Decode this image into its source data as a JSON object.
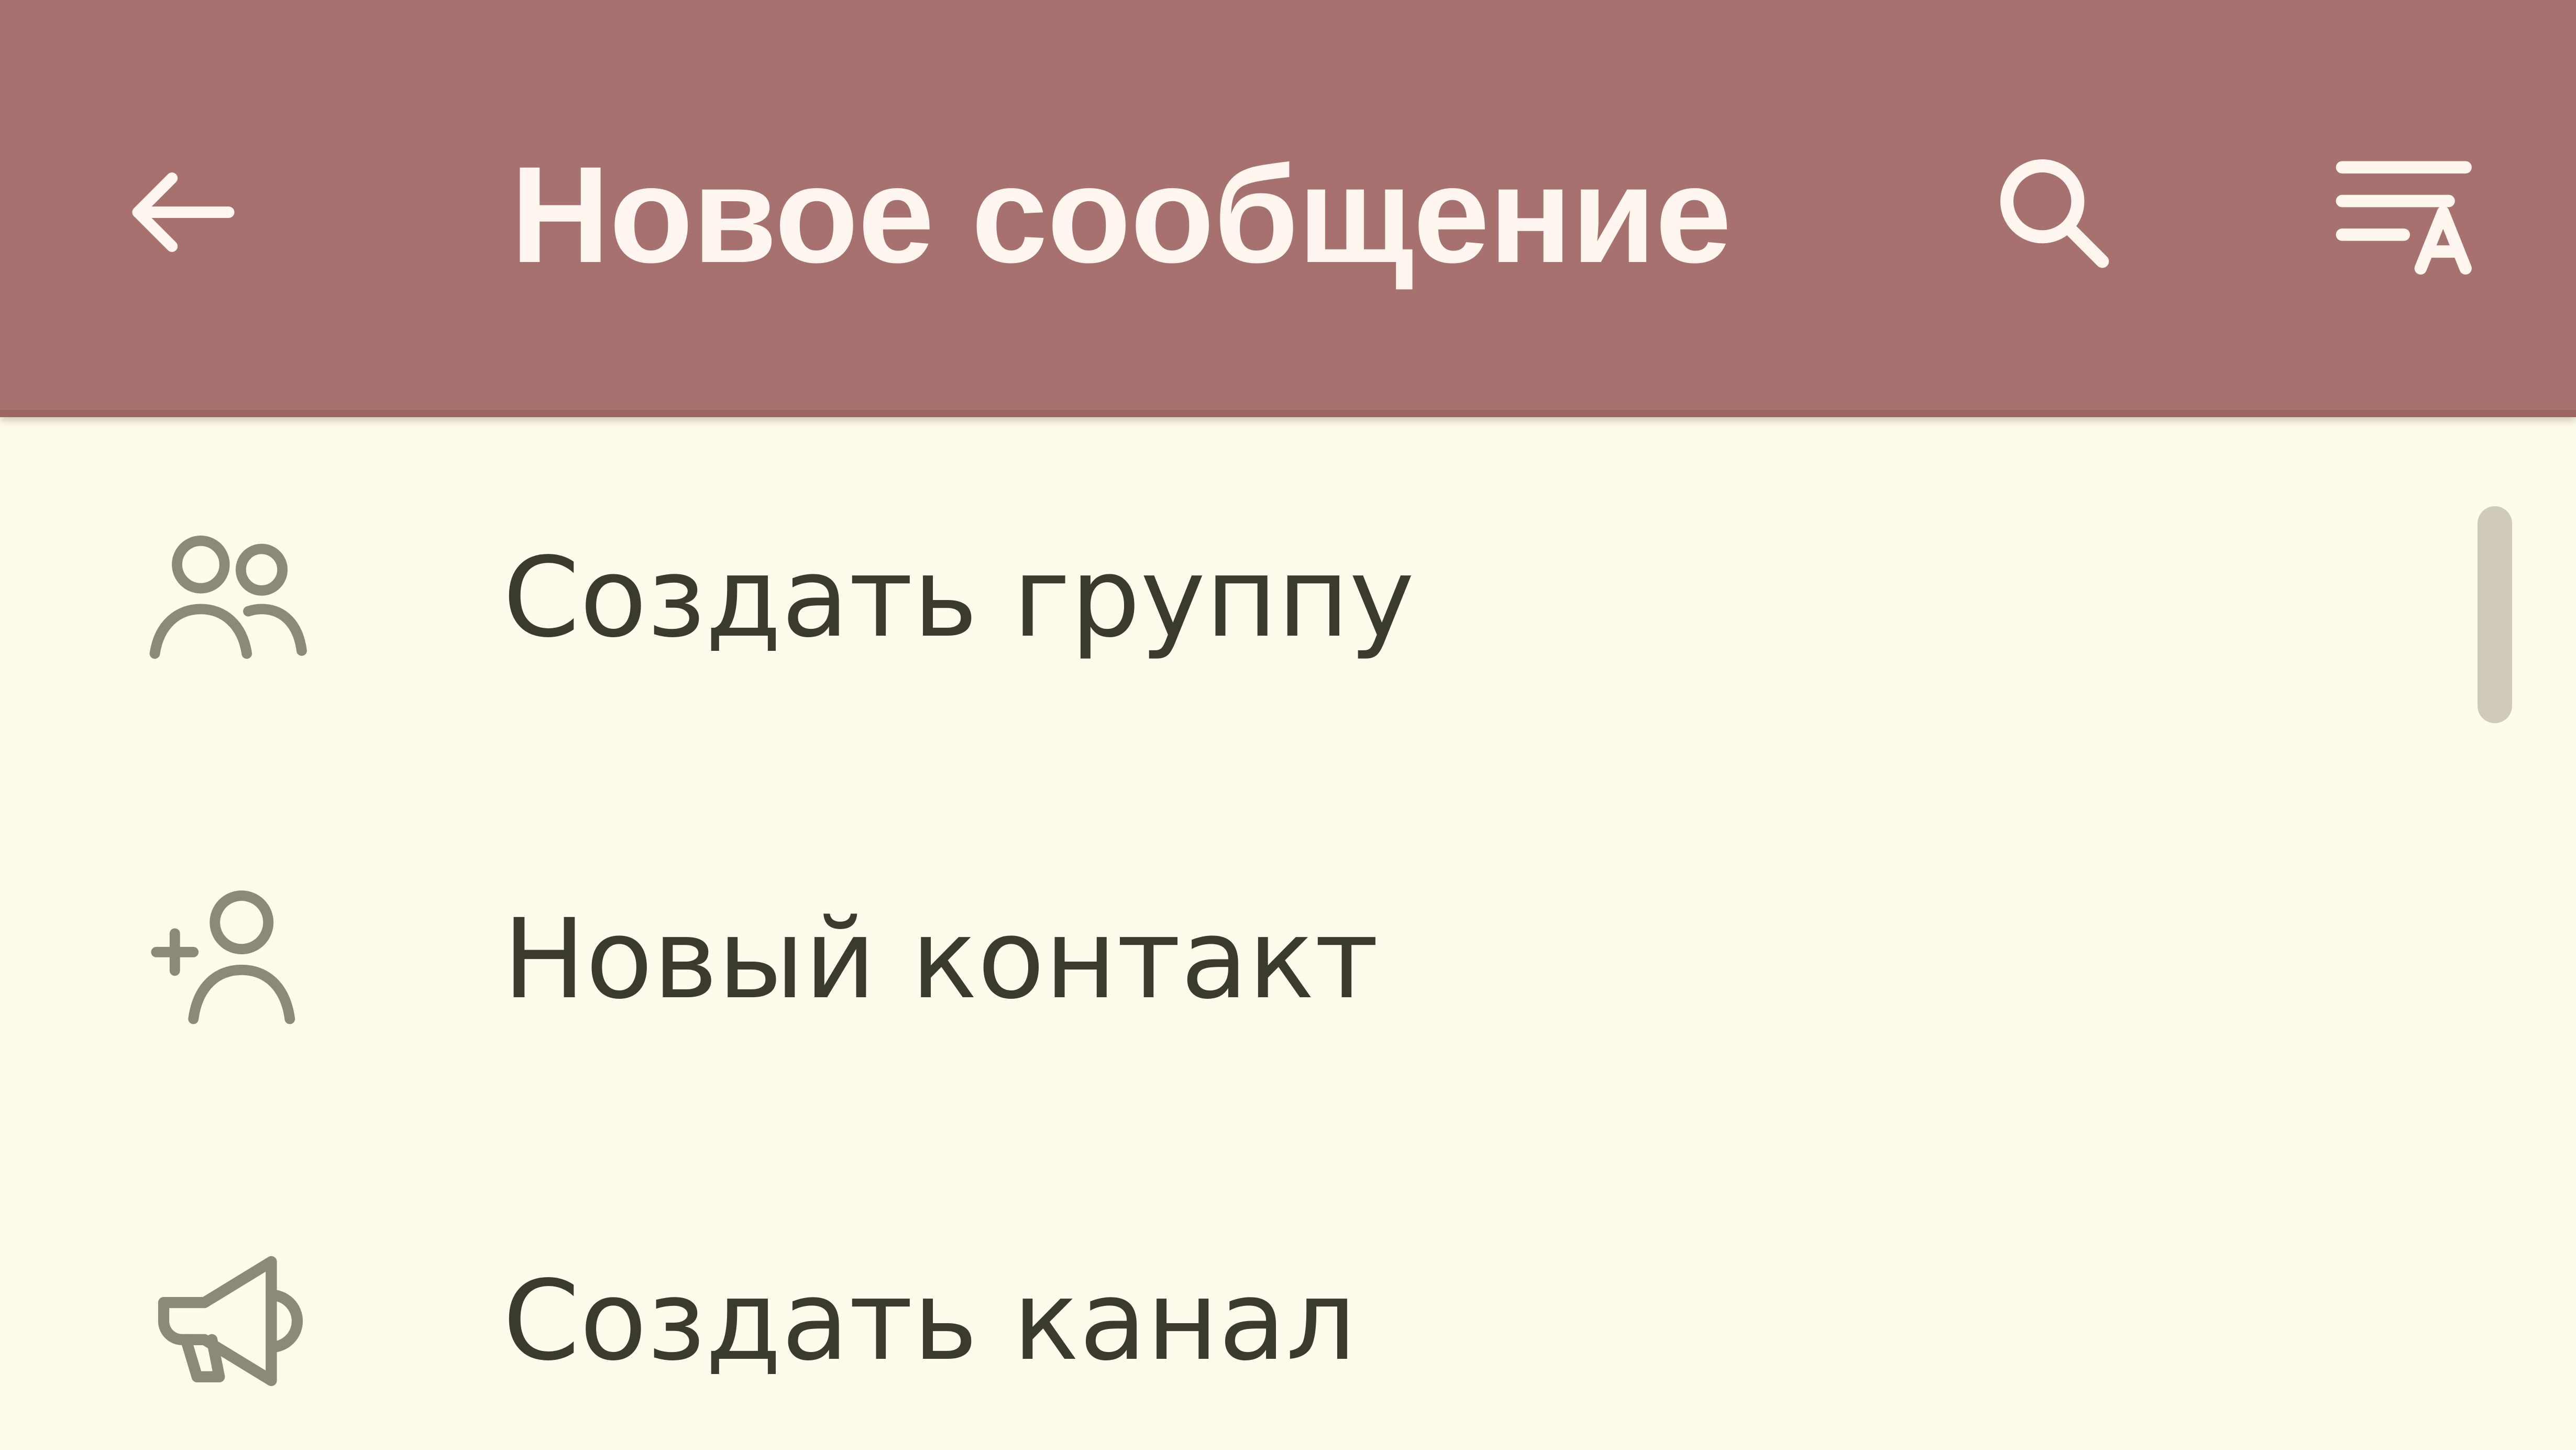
{
  "theme": {
    "header": "#A6716F",
    "background": "#FDFBEB",
    "header_text": "#FFF7EF",
    "item_text": "#3A3A2E",
    "icon_color": "#8B8978"
  },
  "header": {
    "back_icon": "arrow-left-icon",
    "title": "Новое сообщение",
    "search_icon": "search-icon",
    "sort_icon": "sort-by-name-icon"
  },
  "menu": {
    "items": [
      {
        "icon": "group-icon",
        "label": "Создать группу"
      },
      {
        "icon": "add-contact-icon",
        "label": "Новый контакт"
      },
      {
        "icon": "megaphone-icon",
        "label": "Создать канал"
      }
    ]
  }
}
